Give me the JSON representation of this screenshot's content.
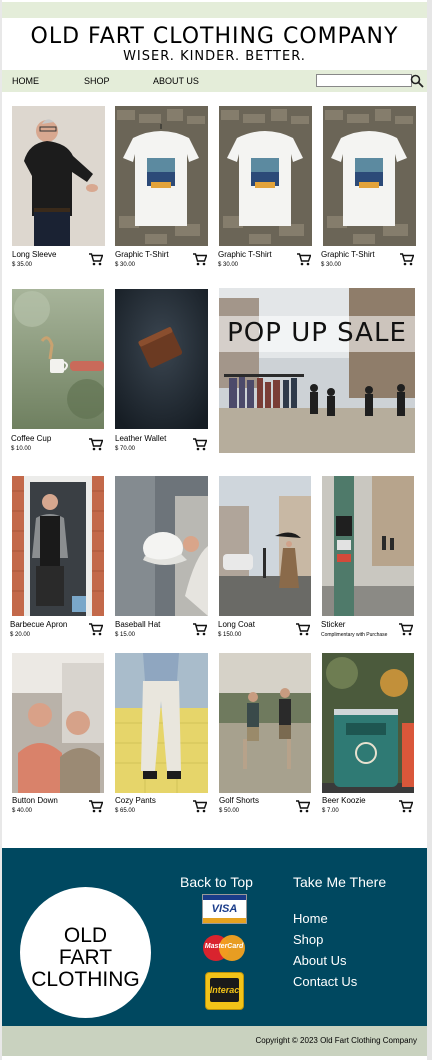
{
  "header": {
    "title": "OLD FART CLOTHING COMPANY",
    "tagline": "WISER. KINDER. BETTER."
  },
  "nav": {
    "items": [
      "HOME",
      "SHOP",
      "ABOUT US"
    ],
    "search_value": ""
  },
  "products": [
    {
      "name": "Long Sleeve",
      "price": "$ 35.00",
      "image": "man-in-black-long-sleeve"
    },
    {
      "name": "Graphic T-Shirt",
      "price": "$ 30.00",
      "image": "graphic-tshirt-on-hanger"
    },
    {
      "name": "Graphic T-Shirt",
      "price": "$ 30.00",
      "image": "graphic-tshirt-on-hanger"
    },
    {
      "name": "Graphic T-Shirt",
      "price": "$ 30.00",
      "image": "graphic-tshirt-on-hanger"
    },
    {
      "name": "Coffee Cup",
      "price": "$ 10.00",
      "image": "coffee-cup"
    },
    {
      "name": "Leather Wallet",
      "price": "$ 70.00",
      "image": "leather-wallet"
    },
    {
      "name": "Barbecue Apron",
      "price": "$ 20.00",
      "image": "man-in-apron"
    },
    {
      "name": "Baseball Hat",
      "price": "$ 15.00",
      "image": "white-baseball-hat"
    },
    {
      "name": "Long Coat",
      "price": "$ 150.00",
      "image": "street-long-coat"
    },
    {
      "name": "Sticker",
      "price": "Complimentary with Purchase",
      "image": "sticker-pole"
    },
    {
      "name": "Button Down",
      "price": "$ 40.00",
      "image": "two-old-men"
    },
    {
      "name": "Cozy Pants",
      "price": "$ 65.00",
      "image": "cozy-pants"
    },
    {
      "name": "Golf Shorts",
      "price": "$ 50.00",
      "image": "golf-shorts"
    },
    {
      "name": "Beer Koozie",
      "price": "$ 7.00",
      "image": "beer-koozie"
    }
  ],
  "promo": {
    "text": "POP UP SALE",
    "image": "market-clothing-rack"
  },
  "footer": {
    "logo_lines": [
      "OLD",
      "FART",
      "CLOTHING"
    ],
    "back_to_top": "Back to Top",
    "take_me_there": "Take Me There",
    "links": [
      "Home",
      "Shop",
      "About Us",
      "Contact Us"
    ],
    "payments": [
      "VISA",
      "MasterCard",
      "Interac"
    ],
    "copyright": "Copyright © 2023 Old Fart Clothing Company"
  },
  "colors": {
    "accent_bar": "#e4edd9",
    "footer": "#004860",
    "copyright_bar": "#c9d2bf"
  }
}
